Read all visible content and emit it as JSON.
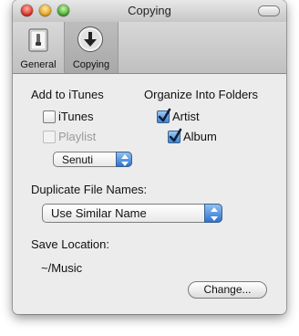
{
  "window": {
    "title": "Copying"
  },
  "toolbar": {
    "items": [
      {
        "label": "General",
        "icon": "switch-icon"
      },
      {
        "label": "Copying",
        "icon": "download-arrow-icon",
        "selected": true
      }
    ]
  },
  "add_to_itunes": {
    "heading": "Add to iTunes",
    "itunes": {
      "label": "iTunes",
      "checked": false
    },
    "playlist": {
      "label": "Playlist",
      "checked": false,
      "enabled": false
    },
    "source": {
      "selected": "Senuti"
    }
  },
  "organize": {
    "heading": "Organize Into Folders",
    "artist": {
      "label": "Artist",
      "checked": true
    },
    "album": {
      "label": "Album",
      "checked": true
    }
  },
  "duplicates": {
    "heading": "Duplicate File Names:",
    "selected": "Use Similar Name"
  },
  "save_location": {
    "heading": "Save Location:",
    "path": "~/Music",
    "change_label": "Change..."
  },
  "colors": {
    "accent": "#3d86d8",
    "window_bg": "#ececec"
  }
}
